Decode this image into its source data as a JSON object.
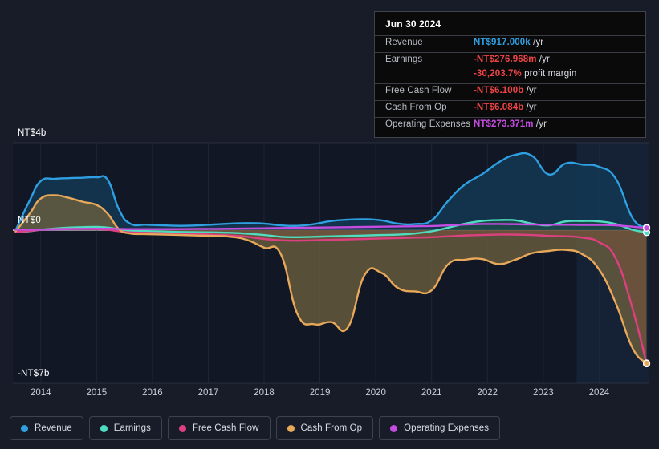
{
  "tooltip": {
    "date": "Jun 30 2024",
    "rows": [
      {
        "label": "Revenue",
        "value": "NT$917.000k",
        "suffix": "/yr",
        "color": "#2e9fe0",
        "first": true
      },
      {
        "label": "Earnings",
        "value": "-NT$276.968m",
        "suffix": "/yr",
        "color": "#ef4444",
        "first": false
      },
      {
        "label": "",
        "value": "-30,203.7%",
        "suffix": "profit margin",
        "color": "#ef4444",
        "first": false,
        "no_line": true
      },
      {
        "label": "Free Cash Flow",
        "value": "-NT$6.100b",
        "suffix": "/yr",
        "color": "#ef4444",
        "first": false
      },
      {
        "label": "Cash From Op",
        "value": "-NT$6.084b",
        "suffix": "/yr",
        "color": "#ef4444",
        "first": false
      },
      {
        "label": "Operating Expenses",
        "value": "NT$273.371m",
        "suffix": "/yr",
        "color": "#c44ce0",
        "first": false
      }
    ]
  },
  "legend": {
    "items": [
      {
        "label": "Revenue",
        "color": "#2e9fe0"
      },
      {
        "label": "Earnings",
        "color": "#4fdcc0"
      },
      {
        "label": "Free Cash Flow",
        "color": "#dd4080"
      },
      {
        "label": "Cash From Op",
        "color": "#e8a85a"
      },
      {
        "label": "Operating Expenses",
        "color": "#c44ce0"
      }
    ]
  },
  "chart_data": {
    "type": "area",
    "title": "",
    "xlabel": "",
    "ylabel": "",
    "currency": "NT$",
    "ylim": [
      -7,
      4
    ],
    "y_ticks": [
      {
        "label": "NT$4b",
        "value": 4
      },
      {
        "label": "NT$0",
        "value": 0
      },
      {
        "label": "-NT$7b",
        "value": -7
      }
    ],
    "x_ticks": [
      "2014",
      "2015",
      "2016",
      "2017",
      "2018",
      "2019",
      "2020",
      "2021",
      "2022",
      "2023",
      "2024"
    ],
    "x_range": [
      2013.5,
      2024.9
    ],
    "grid": true,
    "legend_position": "bottom",
    "forecast_start": "2023.6",
    "x": [
      2013.55,
      2013.8,
      2014.0,
      2014.25,
      2014.5,
      2014.75,
      2015.0,
      2015.2,
      2015.4,
      2015.6,
      2015.9,
      2016.2,
      2016.5,
      2016.8,
      2017.1,
      2017.4,
      2017.7,
      2018.0,
      2018.3,
      2018.6,
      2018.9,
      2019.2,
      2019.5,
      2019.8,
      2020.1,
      2020.4,
      2020.7,
      2021.0,
      2021.3,
      2021.6,
      2021.9,
      2022.2,
      2022.5,
      2022.8,
      2023.1,
      2023.4,
      2023.7,
      2024.0,
      2024.3,
      2024.6,
      2024.85
    ],
    "series": [
      {
        "name": "Revenue",
        "color": "#2e9fe0",
        "fill": "#133a56",
        "values": [
          0.0,
          1.35,
          2.25,
          2.35,
          2.38,
          2.4,
          2.42,
          2.3,
          0.95,
          0.3,
          0.25,
          0.22,
          0.2,
          0.22,
          0.26,
          0.3,
          0.32,
          0.3,
          0.22,
          0.2,
          0.28,
          0.42,
          0.48,
          0.5,
          0.45,
          0.3,
          0.28,
          0.45,
          1.35,
          2.1,
          2.55,
          3.1,
          3.45,
          3.4,
          2.55,
          3.05,
          3.0,
          2.9,
          2.35,
          0.55,
          0.12
        ]
      },
      {
        "name": "Earnings",
        "color": "#4fdcc0",
        "fill": "#1d4d4a",
        "values": [
          -0.1,
          -0.05,
          0.02,
          0.08,
          0.12,
          0.14,
          0.15,
          0.12,
          0.04,
          -0.02,
          -0.04,
          -0.06,
          -0.08,
          -0.09,
          -0.1,
          -0.12,
          -0.16,
          -0.22,
          -0.3,
          -0.32,
          -0.3,
          -0.28,
          -0.26,
          -0.24,
          -0.22,
          -0.2,
          -0.15,
          -0.05,
          0.12,
          0.3,
          0.42,
          0.46,
          0.45,
          0.3,
          0.22,
          0.4,
          0.42,
          0.4,
          0.28,
          0.02,
          -0.1
        ]
      },
      {
        "name": "Free Cash Flow",
        "color": "#dd4080",
        "fill": "#7a2030",
        "values": [
          -0.08,
          -0.04,
          0.02,
          0.05,
          0.06,
          0.06,
          0.05,
          0.02,
          -0.05,
          -0.1,
          -0.12,
          -0.14,
          -0.16,
          -0.18,
          -0.2,
          -0.24,
          -0.3,
          -0.4,
          -0.46,
          -0.48,
          -0.46,
          -0.44,
          -0.42,
          -0.4,
          -0.38,
          -0.36,
          -0.34,
          -0.32,
          -0.28,
          -0.24,
          -0.22,
          -0.2,
          -0.2,
          -0.22,
          -0.26,
          -0.28,
          -0.34,
          -0.55,
          -1.3,
          -3.6,
          -6.1
        ]
      },
      {
        "name": "Cash From Op",
        "color": "#e8a85a",
        "fill": "#6b5f3f",
        "values": [
          -0.05,
          0.75,
          1.45,
          1.6,
          1.48,
          1.3,
          1.15,
          0.75,
          0.05,
          -0.15,
          -0.18,
          -0.2,
          -0.22,
          -0.24,
          -0.26,
          -0.3,
          -0.45,
          -0.8,
          -1.1,
          -3.85,
          -4.3,
          -4.2,
          -4.45,
          -2.05,
          -1.95,
          -2.65,
          -2.8,
          -2.75,
          -1.55,
          -1.35,
          -1.32,
          -1.55,
          -1.35,
          -1.05,
          -0.95,
          -0.9,
          -1.1,
          -1.8,
          -3.35,
          -5.4,
          -6.08
        ]
      },
      {
        "name": "Operating Expenses",
        "color": "#c44ce0",
        "fill": "none",
        "values": [
          0.02,
          0.02,
          0.03,
          0.04,
          0.05,
          0.06,
          0.07,
          0.07,
          0.06,
          0.05,
          0.05,
          0.05,
          0.05,
          0.06,
          0.06,
          0.07,
          0.08,
          0.09,
          0.1,
          0.11,
          0.12,
          0.13,
          0.14,
          0.15,
          0.16,
          0.17,
          0.18,
          0.19,
          0.22,
          0.26,
          0.28,
          0.28,
          0.27,
          0.26,
          0.25,
          0.25,
          0.24,
          0.24,
          0.22,
          0.16,
          0.1
        ]
      }
    ]
  }
}
